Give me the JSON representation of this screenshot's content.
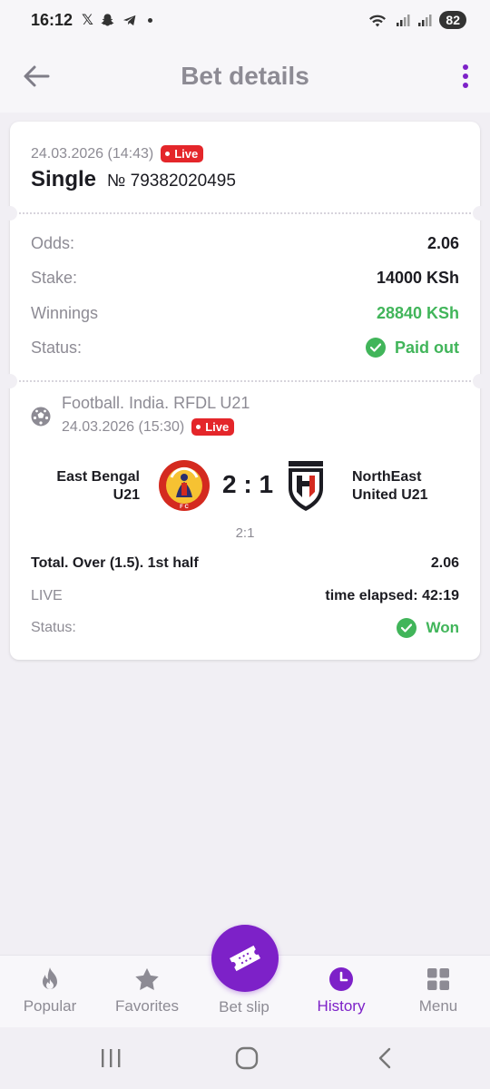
{
  "status_bar": {
    "time": "16:12",
    "battery": "82"
  },
  "header": {
    "title": "Bet details"
  },
  "bet": {
    "date": "24.03.2026 (14:43)",
    "live_label": "Live",
    "type": "Single",
    "number": "№ 79382020495",
    "rows": {
      "odds_label": "Odds:",
      "odds_value": "2.06",
      "stake_label": "Stake:",
      "stake_value": "14000 KSh",
      "winnings_label": "Winnings",
      "winnings_value": "28840 KSh",
      "status_label": "Status:",
      "status_value": "Paid out"
    }
  },
  "event": {
    "title": "Football. India. RFDL U21",
    "date": "24.03.2026 (15:30)",
    "live_label": "Live",
    "team1_line1": "East Bengal",
    "team1_line2": "U21",
    "team2_line1": "NorthEast",
    "team2_line2": "United U21",
    "score": "2 : 1",
    "halftime": "2:1",
    "market": "Total. Over (1.5). 1st half",
    "market_odds": "2.06",
    "state": "LIVE",
    "time_elapsed": "time elapsed: 42:19",
    "status_label": "Status:",
    "status_value": "Won"
  },
  "nav": {
    "popular": "Popular",
    "favorites": "Favorites",
    "betslip": "Bet slip",
    "history": "History",
    "menu": "Menu"
  },
  "colors": {
    "accent": "#7d21c8",
    "success": "#41b55a",
    "live": "#e4262a"
  }
}
